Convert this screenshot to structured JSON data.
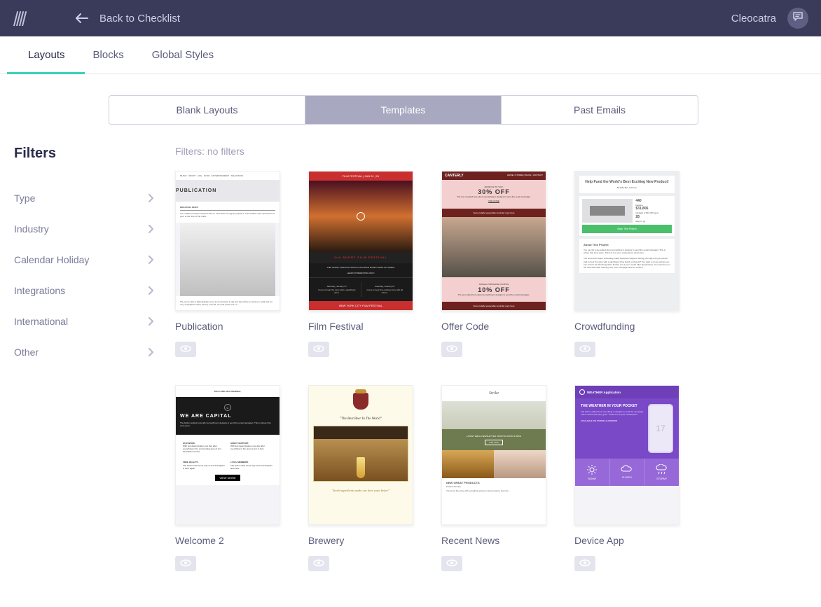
{
  "header": {
    "back_label": "Back to Checklist",
    "username": "Cleocatra"
  },
  "tabs": {
    "t0": "Layouts",
    "t1": "Blocks",
    "t2": "Global Styles"
  },
  "seg": {
    "s0": "Blank Layouts",
    "s1": "Templates",
    "s2": "Past Emails"
  },
  "filters": {
    "heading": "Filters",
    "applied": "Filters: no filters",
    "f0": "Type",
    "f1": "Industry",
    "f2": "Calendar Holiday",
    "f3": "Integrations",
    "f4": "International",
    "f5": "Other"
  },
  "templates": {
    "t0": "Publication",
    "t1": "Film Festival",
    "t2": "Offer Code",
    "t3": "Crowdfunding",
    "t4": "Welcome 2",
    "t5": "Brewery",
    "t6": "Recent News",
    "t7": "Device App"
  },
  "thumbs": {
    "publication_title": "PUBLICATION",
    "film_title_top": "FILM FESTIVAL | JAN 01 | 01",
    "film_sub": "2nd SHORT FILM FESTIVAL",
    "film_bottom": "NEW YORK CITY FILM FESTIVAL",
    "film_d1": "Saturday, January 07",
    "film_d2": "Saturday, January 07",
    "offer_brand": "CANTERLY",
    "offer_from": "FROM US TO YOU:",
    "offer_30": "30% OFF",
    "offer_coupon": "SINGLE PURCHASE COUPON",
    "offer_10": "10% OFF",
    "offer_code": "USE CODE",
    "crowd_title": "Help Fund the World's Best Exciting New Product!",
    "crowd_by": "By Billy Boe Johnson",
    "crowd_440": "440",
    "crowd_backers": "backers",
    "crowd_amt": "$31,806",
    "crowd_pledged": "pledged of $10,000 goal",
    "crowd_28": "28",
    "crowd_days": "days to go",
    "crowd_btn": "Back This Project",
    "crowd_about": "About This Project",
    "welcome_top": "WELCOME NEW MEMBER,",
    "welcome_big": "WE ARE CAPITAL",
    "welcome_work": "OUR WORK.",
    "welcome_support": "GREAT SUPPORT.",
    "welcome_free": "FREE QUALITY.",
    "welcome_members": "1,500+ MEMBERS",
    "welcome_btn": "VIEW MORE",
    "brewery_tag": "\"The Best Beer In The World\"",
    "brewery_foot": "\"fresh ingredients make our beer taste better\"",
    "news_brand": "Strike",
    "news_subject": "LATEST EMAIL NEWSLETTER UPDATES FROM STRIKE",
    "news_btn": "read more",
    "news_new": "NEW GREAT PRODUCTS",
    "device_brand": "WEATHER Application",
    "device_head": "THE WEATHER IN YOUR POCKET",
    "device_num": "17",
    "device_avail": "AVAILABLE ON IPHONE & ANDROID",
    "device_w1": "SUNNY",
    "device_w2": "CLOUDY",
    "device_w3": "STORMY"
  }
}
